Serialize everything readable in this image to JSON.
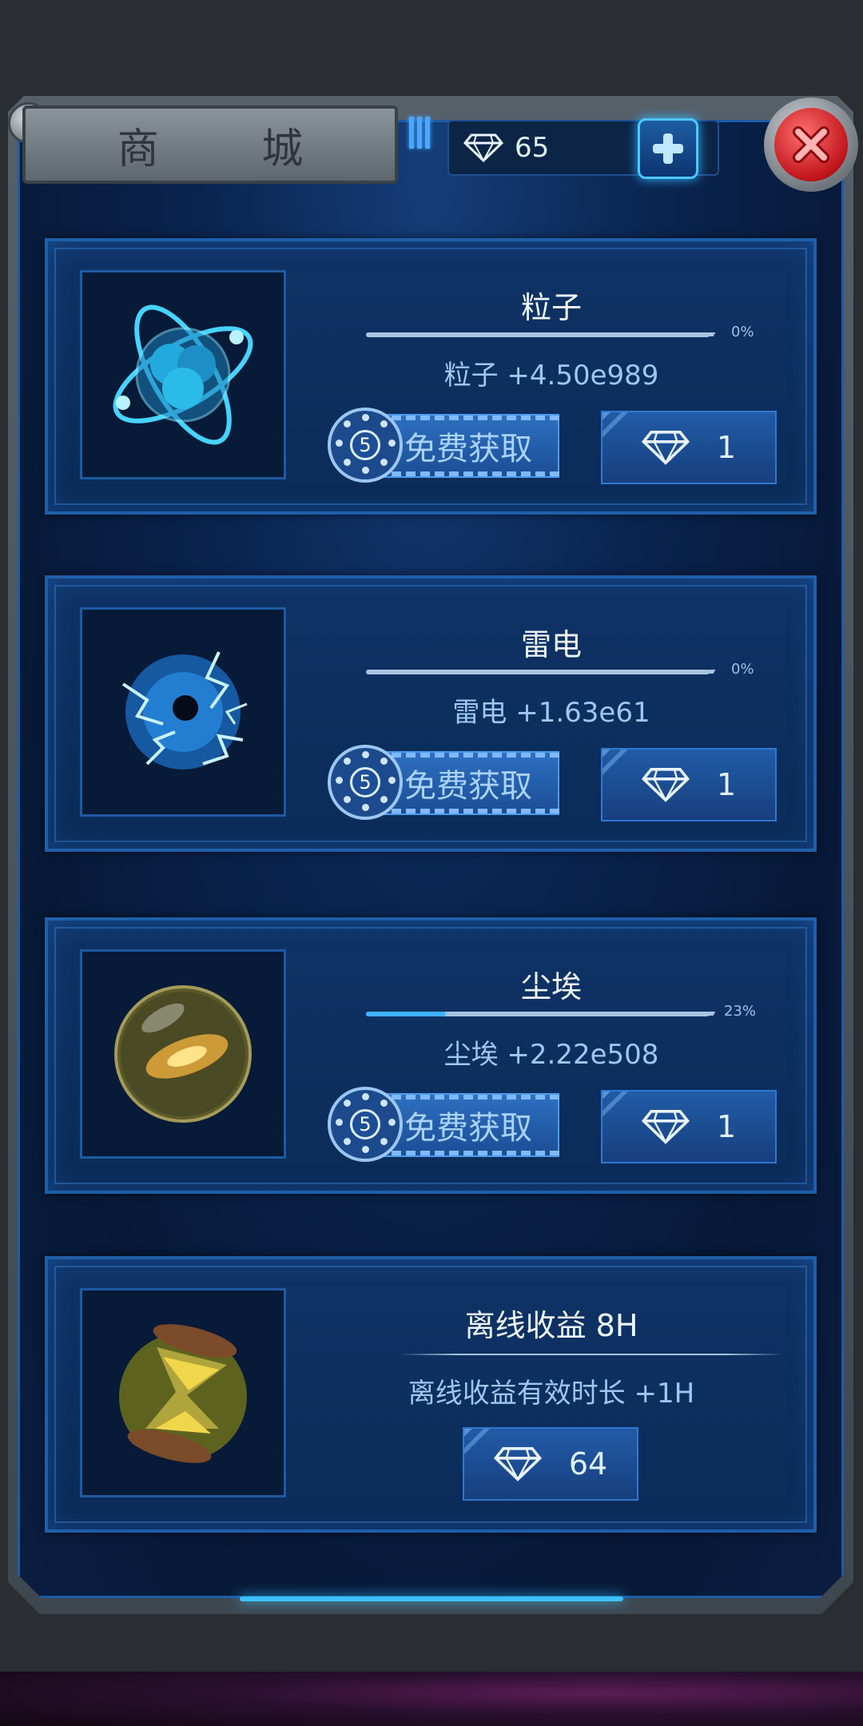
{
  "header": {
    "title": "商 城",
    "gem_count": "65"
  },
  "items": [
    {
      "title": "粒子",
      "progress_pct": 0,
      "progress_label": "0%",
      "reward": "粒子  +4.50e989",
      "free_badge": "5",
      "free_label": "免费获取",
      "price": "1"
    },
    {
      "title": "雷电",
      "progress_pct": 0,
      "progress_label": "0%",
      "reward": "雷电  +1.63e61",
      "free_badge": "5",
      "free_label": "免费获取",
      "price": "1"
    },
    {
      "title": "尘埃",
      "progress_pct": 23,
      "progress_label": "23%",
      "reward": "尘埃  +2.22e508",
      "free_badge": "5",
      "free_label": "免费获取",
      "price": "1"
    }
  ],
  "offline": {
    "title": "离线收益 8H",
    "reward": "离线收益有效时长  +1H",
    "price": "64"
  },
  "icons": [
    "diamond-icon",
    "plus-icon",
    "close-icon",
    "particle-icon",
    "lightning-icon",
    "dust-icon",
    "hourglass-icon",
    "film-reel-icon"
  ],
  "colors": {
    "accent": "#3fb0ff",
    "panel": "#0b2b58",
    "close": "#c0141a"
  }
}
